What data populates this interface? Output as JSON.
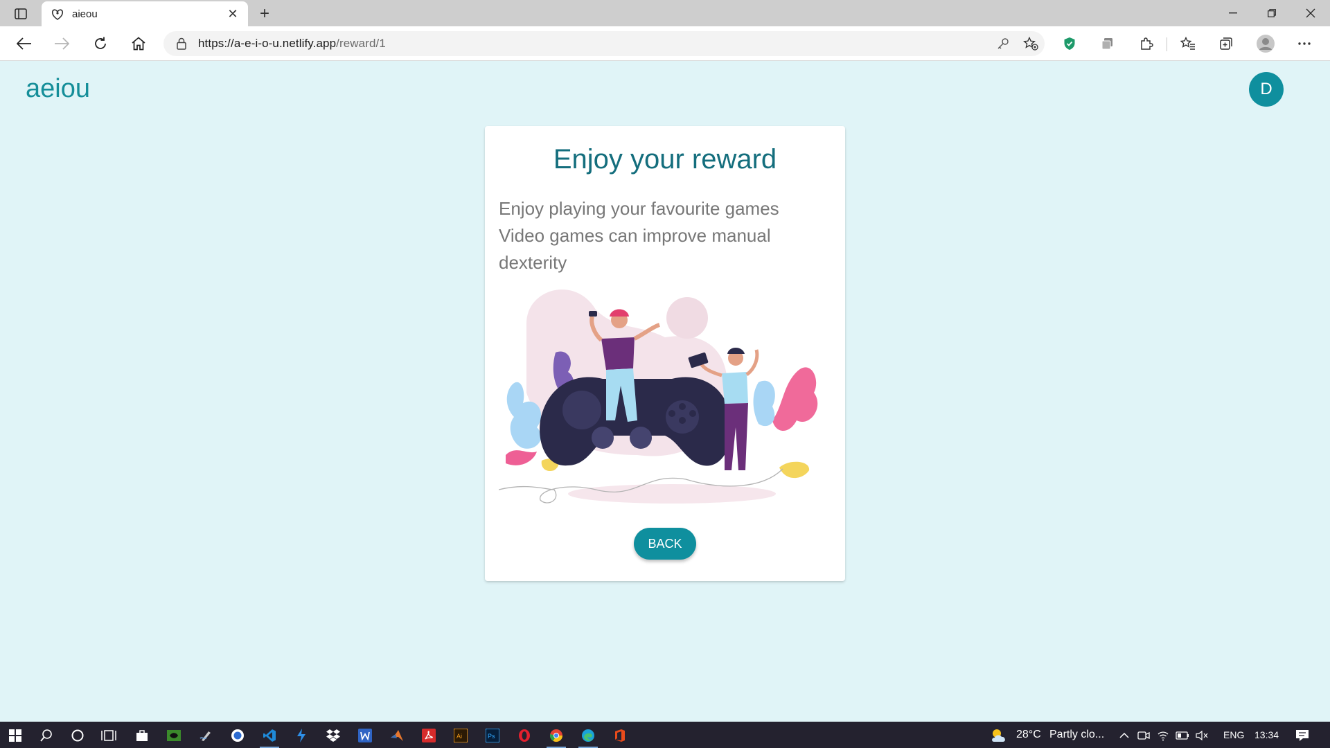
{
  "browser": {
    "tab_title": "aieou",
    "url_host": "https://a-e-i-o-u.netlify.app",
    "url_path": "/reward/1"
  },
  "page": {
    "brand": "aeiou",
    "avatar_initial": "D"
  },
  "card": {
    "title": "Enjoy your reward",
    "line1": "Enjoy playing your favourite games",
    "line2": "Video games can improve manual dexterity",
    "button_label": "BACK"
  },
  "taskbar": {
    "weather_temp": "28°C",
    "weather_desc": "Partly clo...",
    "language": "ENG",
    "time": "13:34"
  },
  "colors": {
    "accent": "#0f8f9e",
    "page_bg": "#e0f4f7",
    "title": "#146e7d"
  }
}
